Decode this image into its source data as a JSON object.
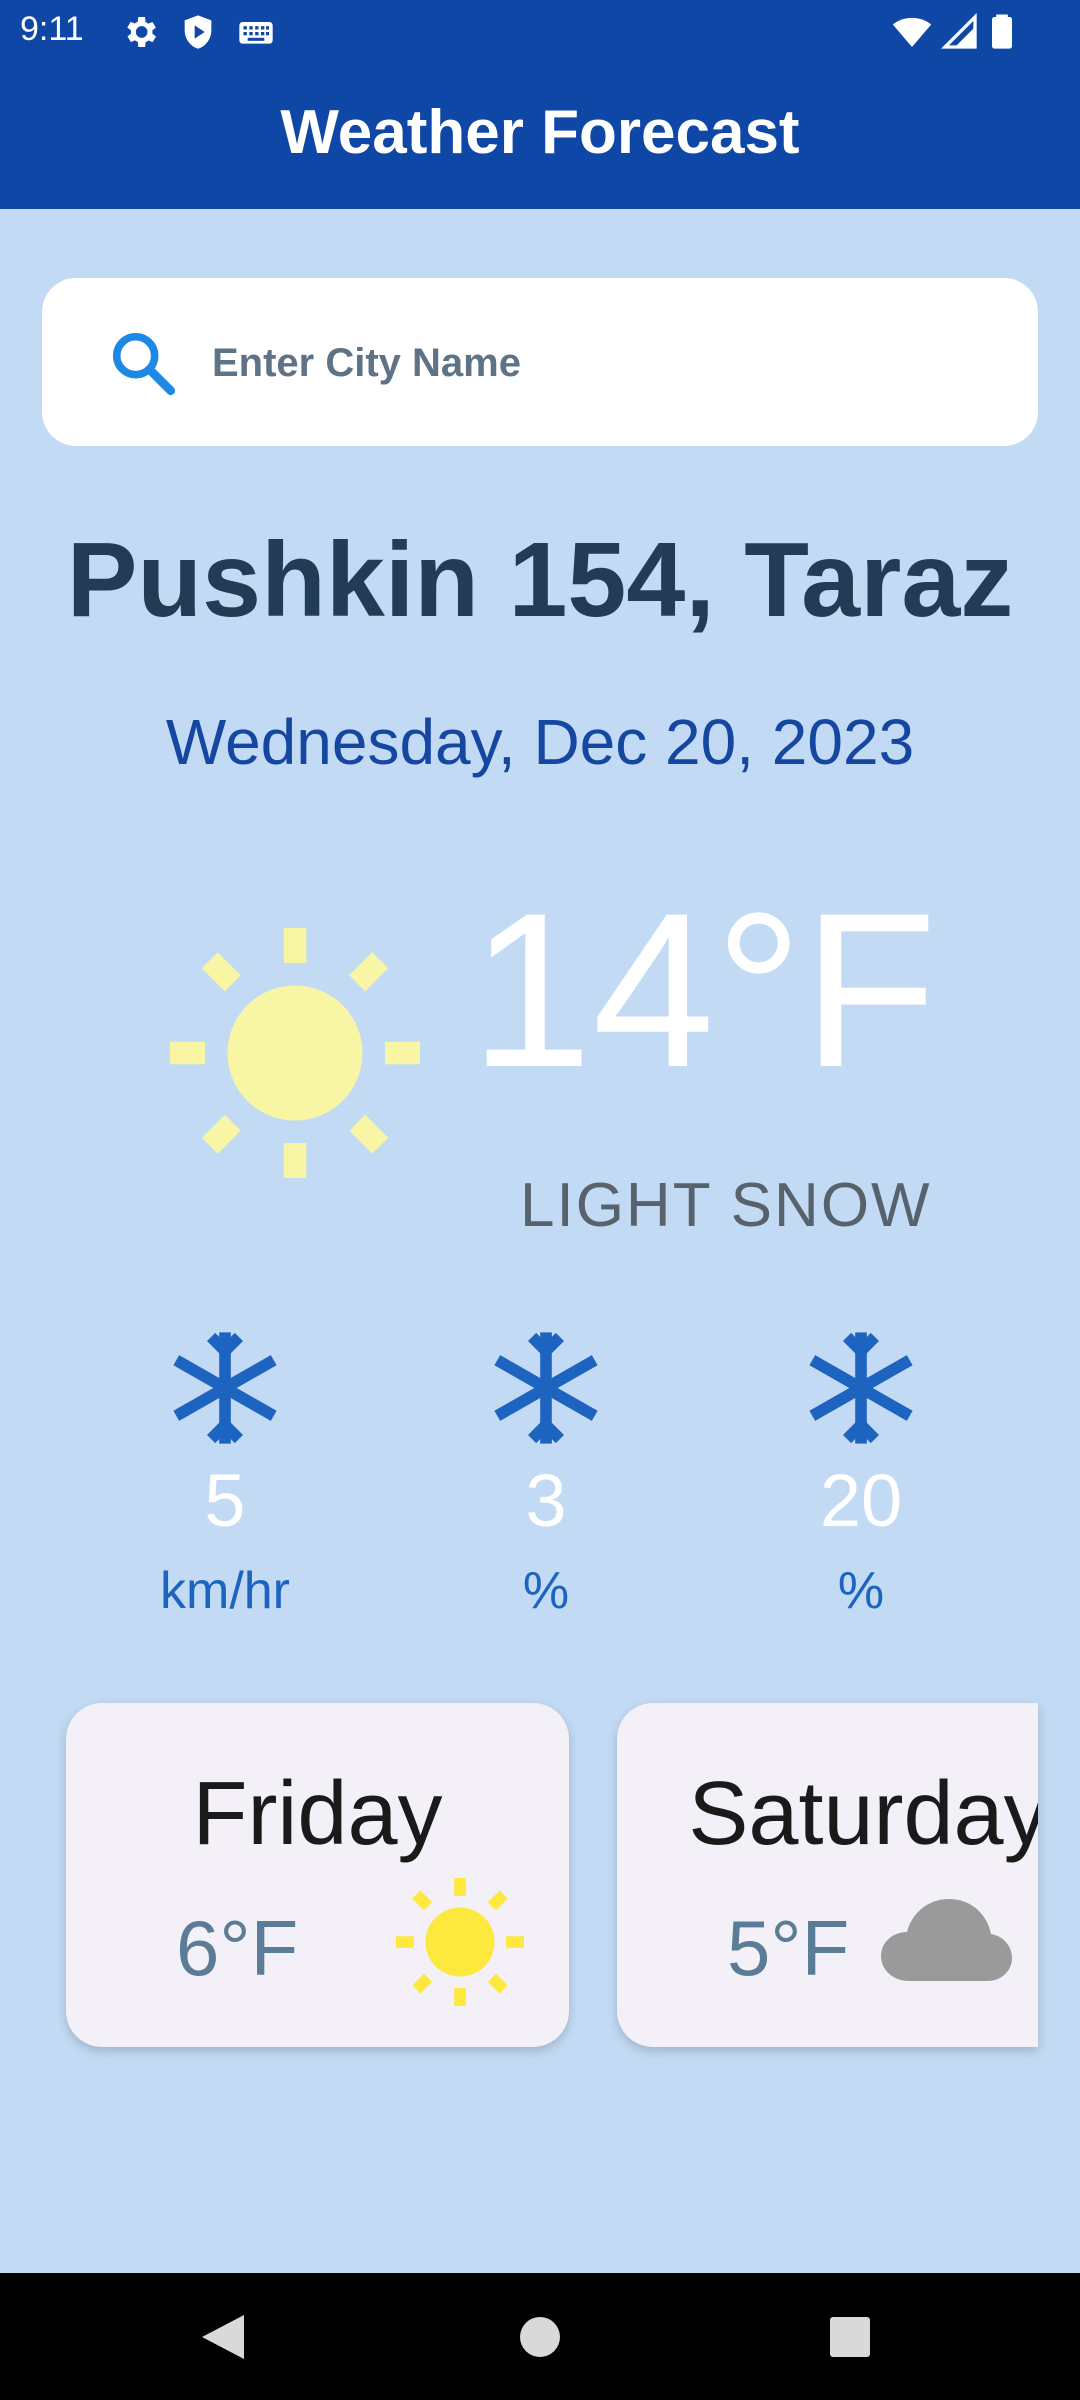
{
  "status_bar": {
    "time": "9:11",
    "icons": [
      "gear-icon",
      "shield-play-icon",
      "keyboard-icon",
      "wifi-icon",
      "signal-icon",
      "battery-icon"
    ]
  },
  "app_bar": {
    "title": "Weather Forecast"
  },
  "search": {
    "placeholder": "Enter City Name",
    "value": ""
  },
  "location": {
    "city": "Pushkin 154, Taraz"
  },
  "date": "Wednesday, Dec 20, 2023",
  "current": {
    "temperature": "14°F",
    "condition": "LIGHT SNOW",
    "icon": "sun-icon"
  },
  "stats": [
    {
      "icon": "snowflake-icon",
      "value": "5",
      "unit": "km/hr"
    },
    {
      "icon": "snowflake-icon",
      "value": "3",
      "unit": "%"
    },
    {
      "icon": "snowflake-icon",
      "value": "20",
      "unit": "%"
    }
  ],
  "forecast": [
    {
      "day": "Friday",
      "temp": "6°F",
      "icon": "sun-icon"
    },
    {
      "day": "Saturday",
      "temp": "5°F",
      "icon": "cloud-icon"
    }
  ],
  "colors": {
    "app_bar": "#0f47a6",
    "background": "#c2daf4",
    "accent": "#1d63c0",
    "sun_main": "#f8f6a5",
    "sun_small": "#fde93d",
    "cloud": "#9a9a9a"
  },
  "navigation": [
    "back-icon",
    "home-icon",
    "recents-icon"
  ]
}
